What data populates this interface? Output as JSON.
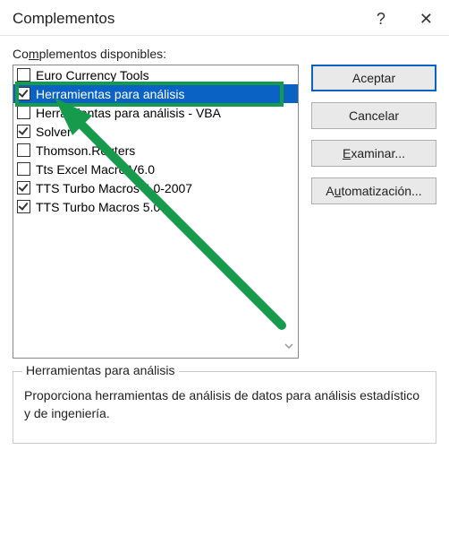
{
  "window": {
    "title": "Complementos",
    "help_icon": "?",
    "close_icon": "✕"
  },
  "list_label_prefix": "Co",
  "list_label_underline": "m",
  "list_label_suffix": "plementos disponibles:",
  "addins": [
    {
      "label": "Euro Currency Tools",
      "checked": false,
      "selected": false
    },
    {
      "label": "Herramientas para análisis",
      "checked": true,
      "selected": true
    },
    {
      "label": "Herramientas para análisis - VBA",
      "checked": false,
      "selected": false
    },
    {
      "label": "Solver",
      "checked": true,
      "selected": false
    },
    {
      "label": "Thomson.Reuters",
      "checked": false,
      "selected": false
    },
    {
      "label": "Tts Excel Macro V6.0",
      "checked": false,
      "selected": false
    },
    {
      "label": "TTS Turbo Macros 4.0-2007",
      "checked": true,
      "selected": false
    },
    {
      "label": "TTS Turbo Macros 5.0",
      "checked": true,
      "selected": false
    }
  ],
  "buttons": {
    "ok": "Aceptar",
    "cancel": "Cancelar",
    "browse_underline": "E",
    "browse_rest": "xaminar...",
    "automate_prefix": "A",
    "automate_underline": "u",
    "automate_suffix": "tomatización..."
  },
  "details": {
    "legend": "Herramientas para análisis",
    "description": "Proporciona herramientas de análisis de datos para análisis estadístico y de ingeniería."
  }
}
